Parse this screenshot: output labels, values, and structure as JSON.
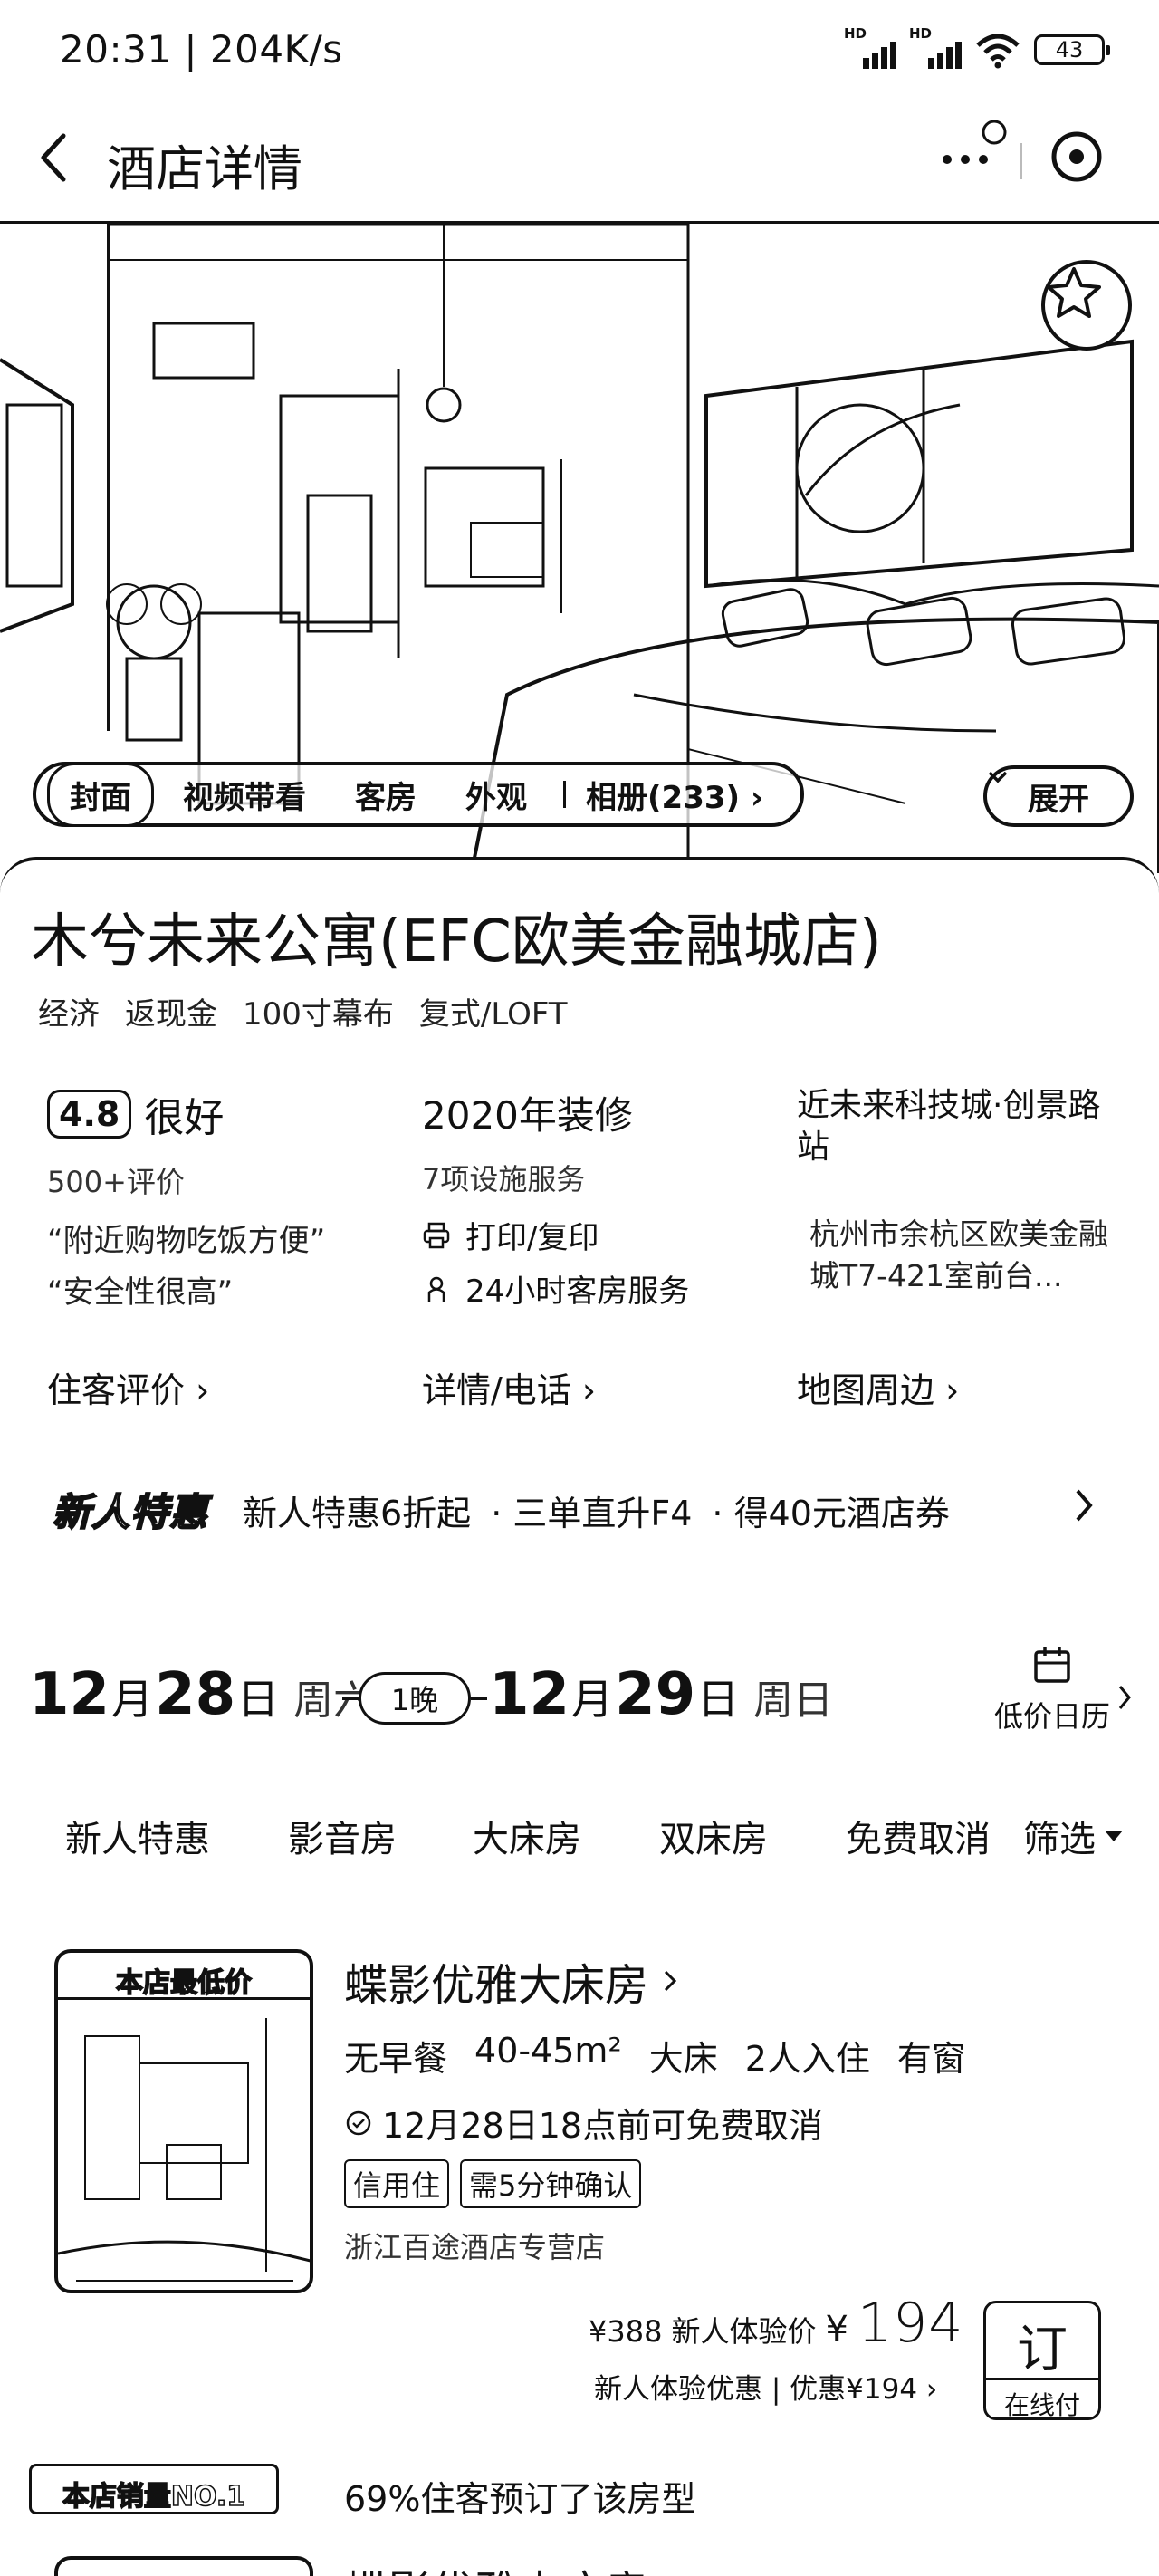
{
  "status_bar": {
    "time": "20:31 | 204K/s",
    "battery": "43",
    "hd1": "HD",
    "hd2": "HD"
  },
  "nav": {
    "title": "酒店详情"
  },
  "gallery": {
    "tabs": [
      "封面",
      "视频带看",
      "客房",
      "外观"
    ],
    "album": "相册(233) ›",
    "expand": "展开"
  },
  "hotel": {
    "name": "木兮未来公寓(EFC欧美金融城店)",
    "tags": [
      "经济",
      "返现金",
      "100寸幕布",
      "复式/LOFT"
    ]
  },
  "reviews": {
    "score": "4.8",
    "rating_word": "很好",
    "count": "500+评价",
    "quotes": [
      "“附近购物吃饭方便”",
      "“安全性很高”"
    ],
    "link": "住客评价 ›"
  },
  "facilities": {
    "renovation": "2020年装修",
    "count": "7项设施服务",
    "items": [
      "打印/复印",
      "24小时客房服务"
    ],
    "link": "详情/电话 ›"
  },
  "location": {
    "nearby": "近未来科技城·创景路站",
    "address": "杭州市余杭区欧美金融城T7-421室前台...",
    "link": "地图周边 ›"
  },
  "promo": {
    "logo": "新人特惠",
    "items": [
      "新人特惠6折起",
      "· 三单直升F4",
      "· 得40元酒店券"
    ]
  },
  "dates": {
    "checkin_month": "12",
    "checkin_day": "28",
    "month_unit": "月",
    "day_unit": "日",
    "checkin_week": "周六",
    "nights": "1晚",
    "checkout_month": "12",
    "checkout_day": "29",
    "checkout_week": "周日",
    "calendar_label": "低价日历"
  },
  "filters": [
    "新人特惠",
    "影音房",
    "大床房",
    "双床房",
    "免费取消",
    "筛选"
  ],
  "room": {
    "badge": "本店最低价",
    "title": "蝶影优雅大床房",
    "specs": [
      "无早餐",
      "40-45m²",
      "大床",
      "2人入住",
      "有窗"
    ],
    "cancel": "12月28日18点前可免费取消",
    "chips": [
      "信用住",
      "需5分钟确认"
    ],
    "shop": "浙江百途酒店专营店",
    "orig_price": "¥388",
    "price_label": "新人体验价",
    "currency": "¥",
    "price": "194",
    "price_note": "新人体验优惠 | 优惠¥194 ›",
    "book_main": "订",
    "book_sub": "在线付"
  },
  "ranking": {
    "badge": "本店销量NO.1",
    "text": "69%住客预订了该房型"
  },
  "room2": {
    "title": "蝶影优雅大床房 ›"
  },
  "colors": {
    "ink": "#111111",
    "background": "#ffffff"
  }
}
